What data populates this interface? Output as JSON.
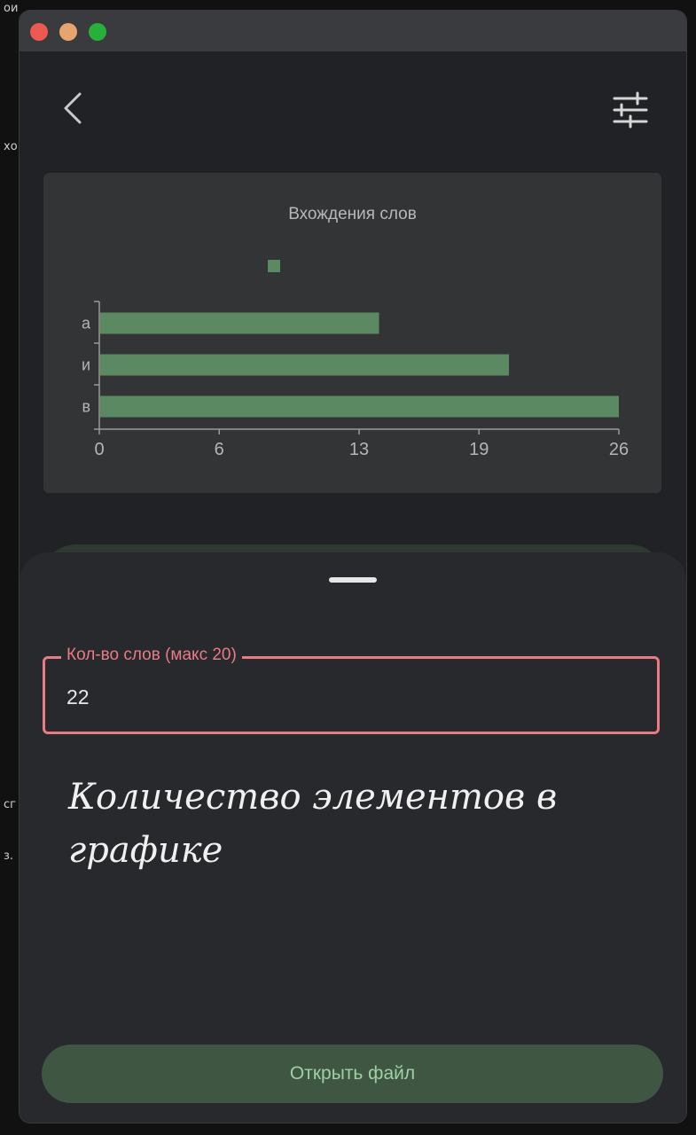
{
  "background_fragments": {
    "top_left": "ои",
    "mid_left": "хо",
    "lower_left_1": "сг",
    "lower_left_2": "з."
  },
  "header": {
    "back_icon": "chevron-left-icon",
    "settings_icon": "sliders-icon"
  },
  "chart_data": {
    "type": "bar",
    "orientation": "horizontal",
    "title": "Вхождения слов",
    "legend_label": "",
    "categories": [
      "а",
      "и",
      "в"
    ],
    "values": [
      14,
      20.5,
      26
    ],
    "xticks": [
      "0",
      "6",
      "13",
      "19",
      "26"
    ],
    "xlim": [
      0,
      26
    ],
    "bar_color": "#5b8a62",
    "grid": false,
    "legend_position": "top-center"
  },
  "sheet": {
    "field_label": "Кол-во слов (макс 20)",
    "field_value": "22",
    "note": "Количество элементов в графике",
    "open_button": "Открыть файл"
  },
  "colors": {
    "accent_error": "#e87b86",
    "button_bg": "#3f5643",
    "button_text": "#9fd0a4"
  }
}
